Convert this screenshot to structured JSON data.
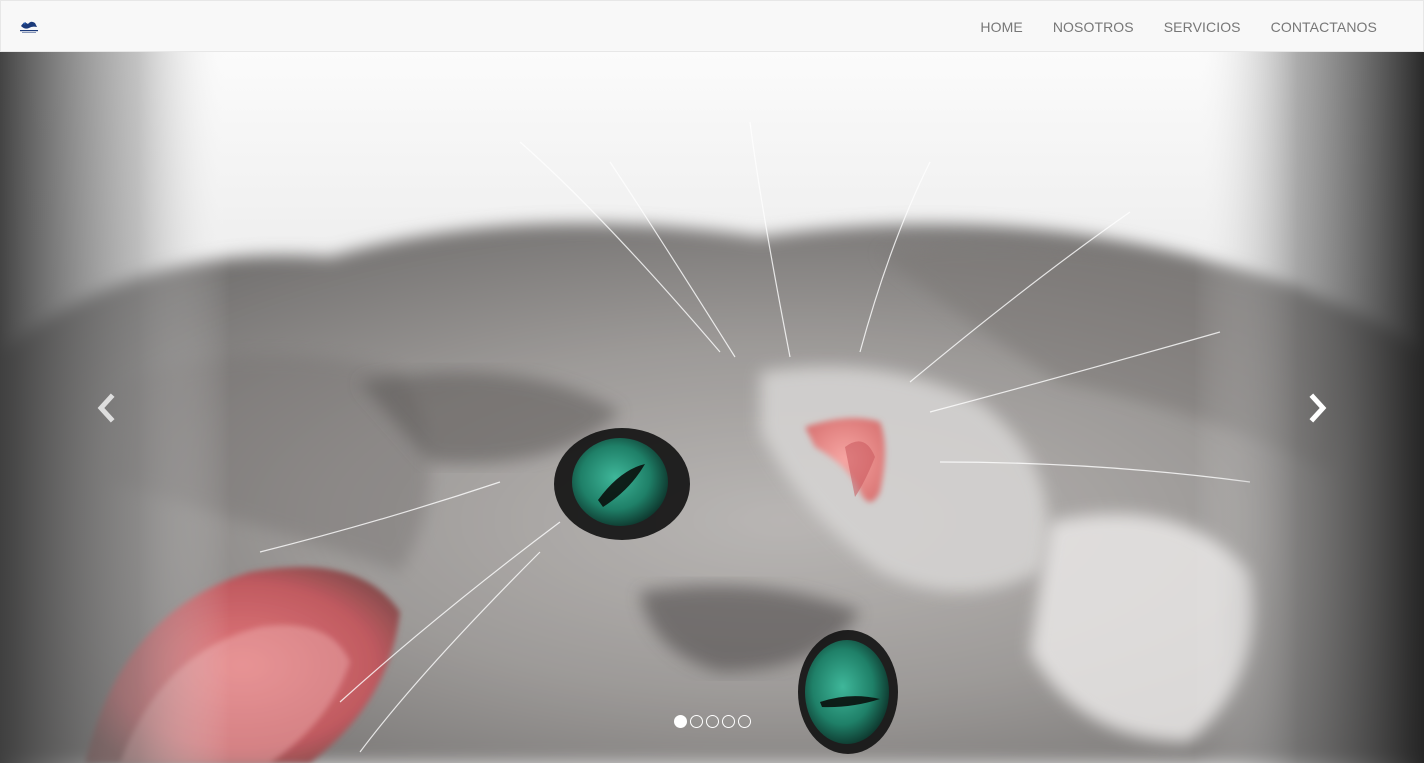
{
  "navbar": {
    "brand_icon": "brand-logo-icon",
    "links": [
      {
        "label": "HOME"
      },
      {
        "label": "NOSOTROS"
      },
      {
        "label": "SERVICIOS"
      },
      {
        "label": "CONTACTANOS"
      }
    ]
  },
  "carousel": {
    "slide_image": "kitten-photo",
    "prev_icon": "chevron-left-icon",
    "next_icon": "chevron-right-icon",
    "slide_count": 5,
    "active_slide": 1
  },
  "colors": {
    "navbar_bg": "#f8f8f8",
    "nav_link": "#777777",
    "brand_blue": "#1b3a7a"
  }
}
